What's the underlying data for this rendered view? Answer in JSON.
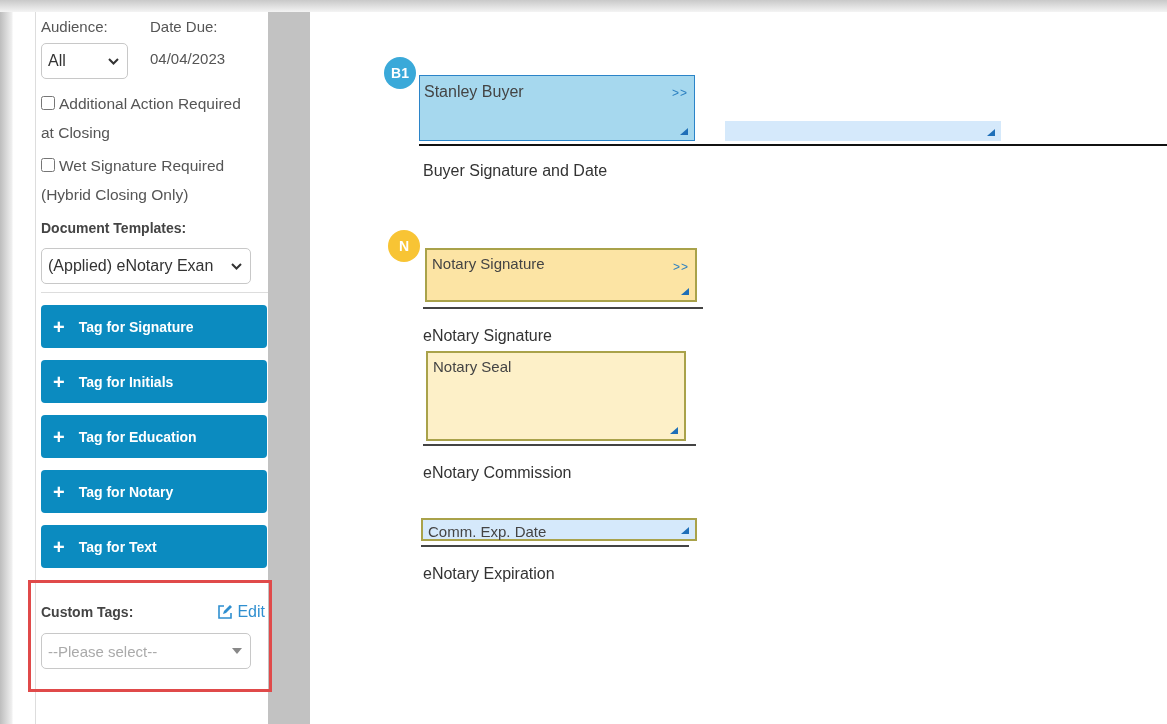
{
  "sidebar": {
    "audience": {
      "label": "Audience:",
      "value": "All"
    },
    "date_due": {
      "label": "Date Due:",
      "value": "04/04/2023"
    },
    "checkboxes": [
      {
        "label": "Additional Action Required at Closing",
        "checked": false
      },
      {
        "label": "Wet Signature Required (Hybrid Closing Only)",
        "checked": false
      }
    ],
    "document_templates": {
      "label": "Document Templates:",
      "value": "(Applied) eNotary Exan"
    },
    "tag_buttons": [
      {
        "icon": "+",
        "label": "Tag for Signature"
      },
      {
        "icon": "+",
        "label": "Tag for Initials"
      },
      {
        "icon": "+",
        "label": "Tag for Education"
      },
      {
        "icon": "+",
        "label": "Tag for Notary"
      },
      {
        "icon": "+",
        "label": "Tag for Text"
      }
    ],
    "custom_tags": {
      "label": "Custom Tags:",
      "edit": "Edit",
      "placeholder": "--Please select--"
    }
  },
  "document": {
    "blocks": [
      {
        "kind": "signature_date",
        "badge": "B1",
        "color": "#3aa9d9",
        "tag": "Stanley Buyer",
        "next": ">>",
        "caption": "Buyer Signature and Date"
      },
      {
        "kind": "signature",
        "badge": "N",
        "color": "#f8c434",
        "tag": "Notary Signature",
        "next": ">>",
        "caption": "eNotary Signature"
      },
      {
        "kind": "seal",
        "tag": "Notary Seal",
        "caption": "eNotary Commission"
      },
      {
        "kind": "date",
        "tag": "Comm. Exp. Date",
        "caption": "eNotary Expiration"
      }
    ]
  }
}
